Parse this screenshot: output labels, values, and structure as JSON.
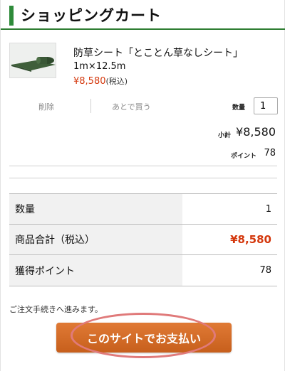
{
  "header": {
    "title": "ショッピングカート"
  },
  "product": {
    "image_icon": "grass-sheet-roll-image",
    "name": "防草シート「とことん草なしシート」",
    "size": "1m×12.5m",
    "price": "¥8,580",
    "price_tax_note": "(税込)",
    "delete_label": "削除",
    "save_later_label": "あとで買う",
    "quantity_label": "数量",
    "quantity_value": "1",
    "subtotal_label": "小計",
    "subtotal_value": "¥8,580",
    "points_label": "ポイント",
    "points_value": "78"
  },
  "summary": {
    "rows": [
      {
        "label": "数量",
        "value": "1"
      },
      {
        "label": "商品合計（税込）",
        "value": "¥8,580"
      },
      {
        "label": "獲得ポイント",
        "value": "78"
      }
    ]
  },
  "checkout": {
    "note": "ご注文手続きへ進みます。",
    "button_label": "このサイトでお支払い"
  },
  "colors": {
    "accent_green": "#2e8b3a",
    "price_red": "#d4380d",
    "button_orange": "#d86c26",
    "highlight_circle": "#e07a7a"
  }
}
